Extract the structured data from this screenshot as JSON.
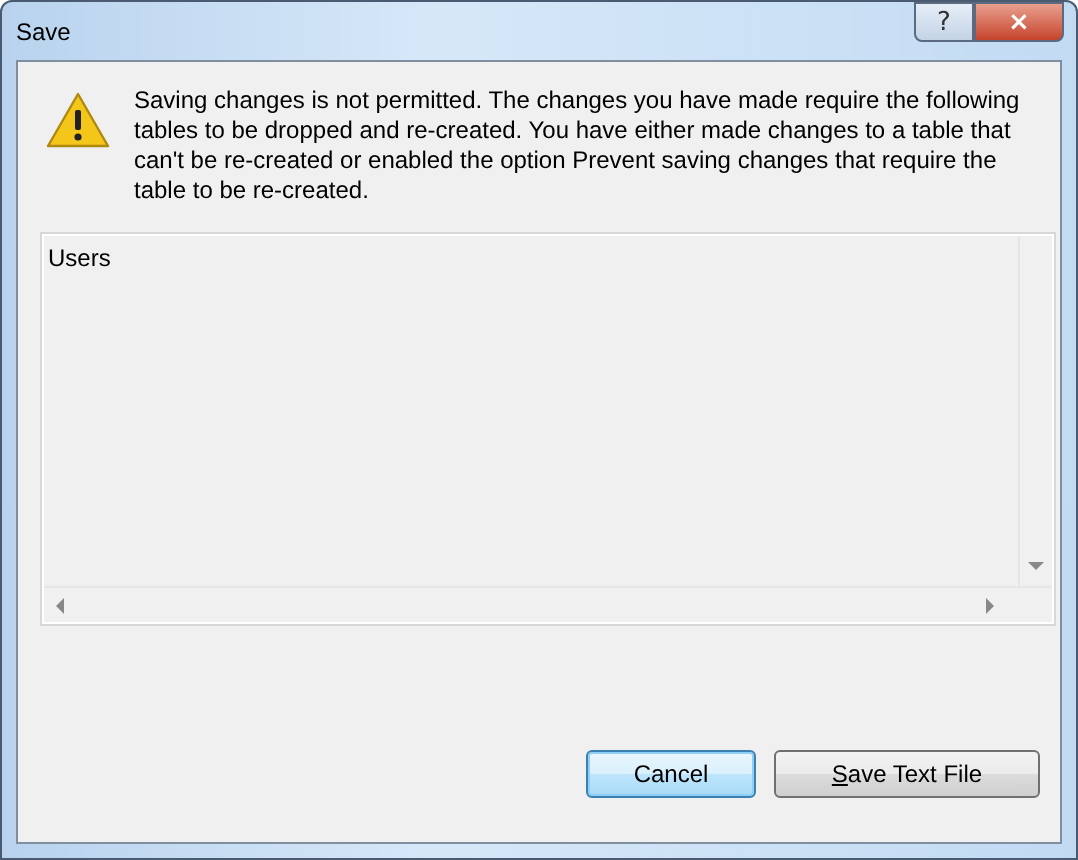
{
  "window": {
    "title": "Save",
    "help_button": "?",
    "close_button": "×"
  },
  "message": "Saving changes is not permitted. The changes you have made require the following tables to be dropped and re-created. You have either made changes to a table that can't be re-created or enabled the option Prevent saving changes that require the table to be re-created.",
  "tables": [
    {
      "name": "Users"
    }
  ],
  "buttons": [
    {
      "label": "Cancel",
      "default": true,
      "underline_first": false
    },
    {
      "label": "Save Text File",
      "default": false,
      "underline_first": true
    }
  ]
}
